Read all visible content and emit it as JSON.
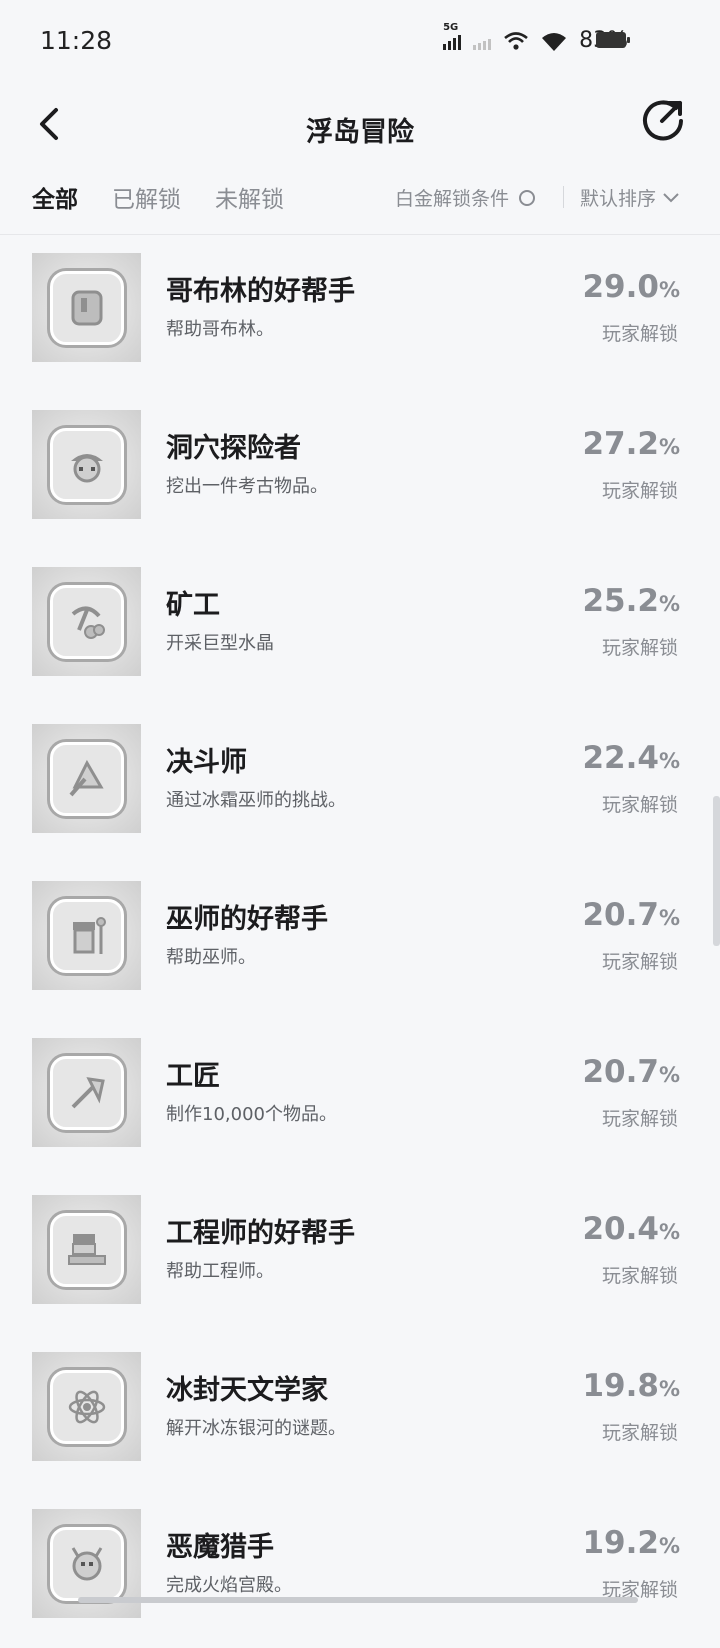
{
  "status": {
    "time": "11:28",
    "network": "5G",
    "battery": "83%"
  },
  "nav": {
    "title": "浮岛冒险",
    "back_icon": "chevron-left-icon",
    "share_icon": "share-icon"
  },
  "filters": {
    "tabs": [
      {
        "label": "全部",
        "active": true
      },
      {
        "label": "已解锁",
        "active": false
      },
      {
        "label": "未解锁",
        "active": false
      }
    ],
    "platinum_label": "白金解锁条件",
    "sort_label": "默认排序"
  },
  "achievements": [
    {
      "title": "哥布林的好帮手",
      "desc": "帮助哥布林。",
      "pct": "29.0",
      "unit": "%",
      "label": "玩家解锁",
      "icon": "goblin-icon"
    },
    {
      "title": "洞穴探险者",
      "desc": "挖出一件考古物品。",
      "pct": "27.2",
      "unit": "%",
      "label": "玩家解锁",
      "icon": "explorer-hat-icon"
    },
    {
      "title": "矿工",
      "desc": "开采巨型水晶",
      "pct": "25.2",
      "unit": "%",
      "label": "玩家解锁",
      "icon": "pickaxe-icon"
    },
    {
      "title": "决斗师",
      "desc": "通过冰霜巫师的挑战。",
      "pct": "22.4",
      "unit": "%",
      "label": "玩家解锁",
      "icon": "shield-sword-icon"
    },
    {
      "title": "巫师的好帮手",
      "desc": "帮助巫师。",
      "pct": "20.7",
      "unit": "%",
      "label": "玩家解锁",
      "icon": "wizard-icon"
    },
    {
      "title": "工匠",
      "desc": "制作10,000个物品。",
      "pct": "20.7",
      "unit": "%",
      "label": "玩家解锁",
      "icon": "axe-icon"
    },
    {
      "title": "工程师的好帮手",
      "desc": "帮助工程师。",
      "pct": "20.4",
      "unit": "%",
      "label": "玩家解锁",
      "icon": "engineer-icon"
    },
    {
      "title": "冰封天文学家",
      "desc": "解开冰冻银河的谜题。",
      "pct": "19.8",
      "unit": "%",
      "label": "玩家解锁",
      "icon": "atom-icon"
    },
    {
      "title": "恶魔猎手",
      "desc": "完成火焰宫殿。",
      "pct": "19.2",
      "unit": "%",
      "label": "玩家解锁",
      "icon": "demon-icon"
    }
  ]
}
